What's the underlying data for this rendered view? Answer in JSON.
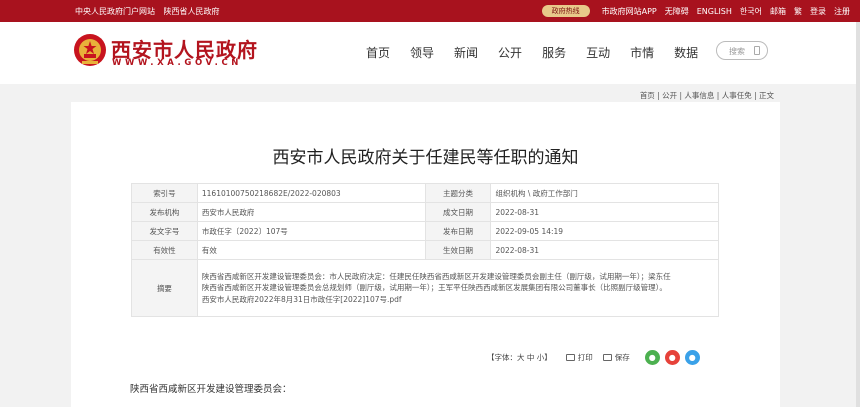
{
  "topbar": {
    "left_links": [
      "中央人民政府门户网站",
      "陕西省人民政府"
    ],
    "pill": "政府热线",
    "right_links": [
      "市政府网站APP",
      "无障碍",
      "ENGLISH",
      "한국어",
      "邮箱",
      "繁",
      "登录",
      "注册"
    ]
  },
  "header": {
    "logo_cn": "西安市人民政府",
    "logo_en": "WWW.XA.GOV.CN",
    "nav": [
      "首页",
      "领导",
      "新闻",
      "公开",
      "服务",
      "互动",
      "市情",
      "数据"
    ],
    "search_placeholder": "搜索"
  },
  "breadcrumb": "首页 | 公开 | 人事信息 | 人事任免 | 正文",
  "article": {
    "title": "西安市人民政府关于任建民等任职的通知",
    "meta": {
      "index_label": "索引号",
      "index_value": "11610100750218682E/2022-020803",
      "topic_label": "主题分类",
      "topic_value": "组织机构 \\ 政府工作部门",
      "issuer_label": "发布机构",
      "issuer_value": "西安市人民政府",
      "created_label": "成文日期",
      "created_value": "2022-08-31",
      "docno_label": "发文字号",
      "docno_value": "市政任字〔2022〕107号",
      "published_label": "发布日期",
      "published_value": "2022-09-05 14:19",
      "validity_label": "有效性",
      "validity_value": "有效",
      "effective_label": "生效日期",
      "effective_value": "2022-08-31",
      "summary_label": "摘要",
      "summary_line1": "陕西省西咸新区开发建设管理委员会：市人民政府决定：任建民任陕西省西咸新区开发建设管理委员会副主任（副厅级，试用期一年）；梁东任",
      "summary_line2": "陕西省西咸新区开发建设管理委员会总规划师（副厅级，试用期一年）；王军平任陕西西咸新区发展集团有限公司董事长（比照副厅级管理）。",
      "summary_line3": "西安市人民政府2022年8月31日市政任字[2022]107号.pdf"
    },
    "tools": {
      "font_size": "【字体：大 中 小】",
      "print": "打印",
      "save": "保存"
    },
    "first_line": "陕西省西咸新区开发建设管理委员会："
  },
  "colors": {
    "brand_red": "#a8121e",
    "logo_red": "#b3141e"
  },
  "icons": [
    "national-emblem-icon",
    "search-icon",
    "print-icon",
    "save-icon",
    "wechat-icon",
    "weibo-icon",
    "qq-icon"
  ]
}
